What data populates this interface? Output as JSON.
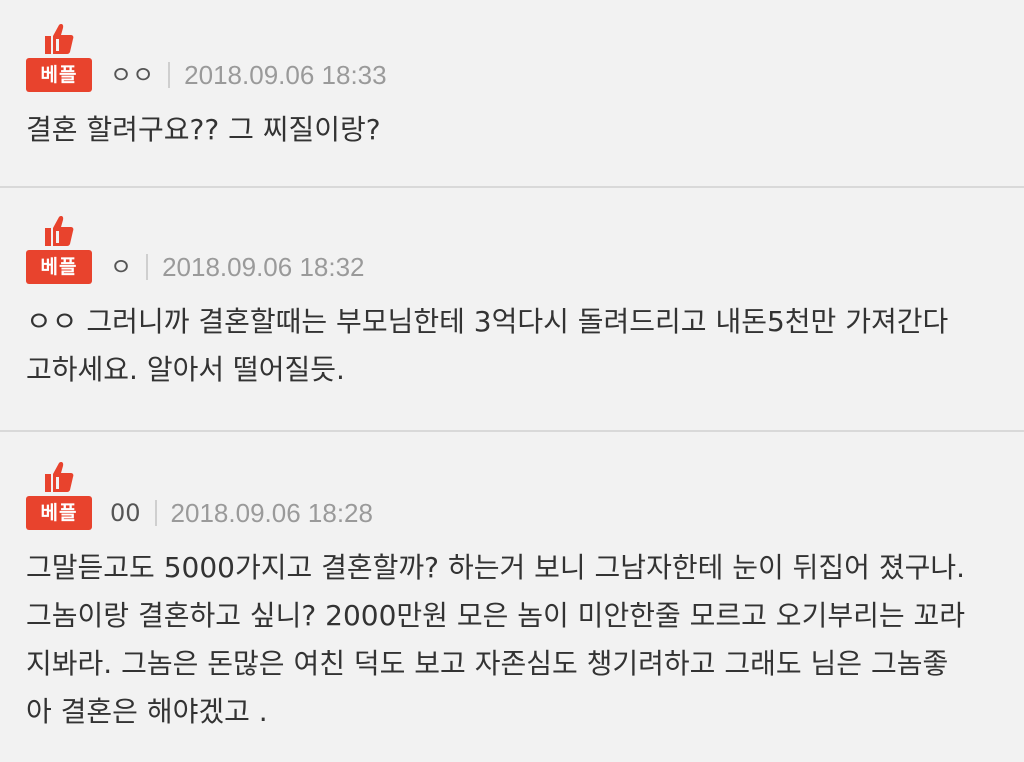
{
  "badge_label": "베플",
  "accent_color": "#e8432d",
  "comments": [
    {
      "author": "ㅇㅇ",
      "date": "2018.09.06 18:33",
      "text": "결혼 할려구요?? 그 찌질이랑?"
    },
    {
      "author": "ㅇ",
      "date": "2018.09.06 18:32",
      "text": "ㅇㅇ 그러니까 결혼할때는 부모님한테 3억다시 돌려드리고 내돈5천만 가져간다\n고하세요. 알아서 떨어질듯."
    },
    {
      "author": "00",
      "date": "2018.09.06 18:28",
      "text": "그말듣고도 5000가지고 결혼할까? 하는거 보니 그남자한테 눈이 뒤집어 졌구나.\n그놈이랑 결혼하고 싶니? 2000만원 모은 놈이 미안한줄 모르고 오기부리는 꼬라\n지봐라. 그놈은 돈많은 여친 덕도 보고 자존심도 챙기려하고 그래도 님은 그놈좋\n아 결혼은 해야겠고 ."
    }
  ]
}
